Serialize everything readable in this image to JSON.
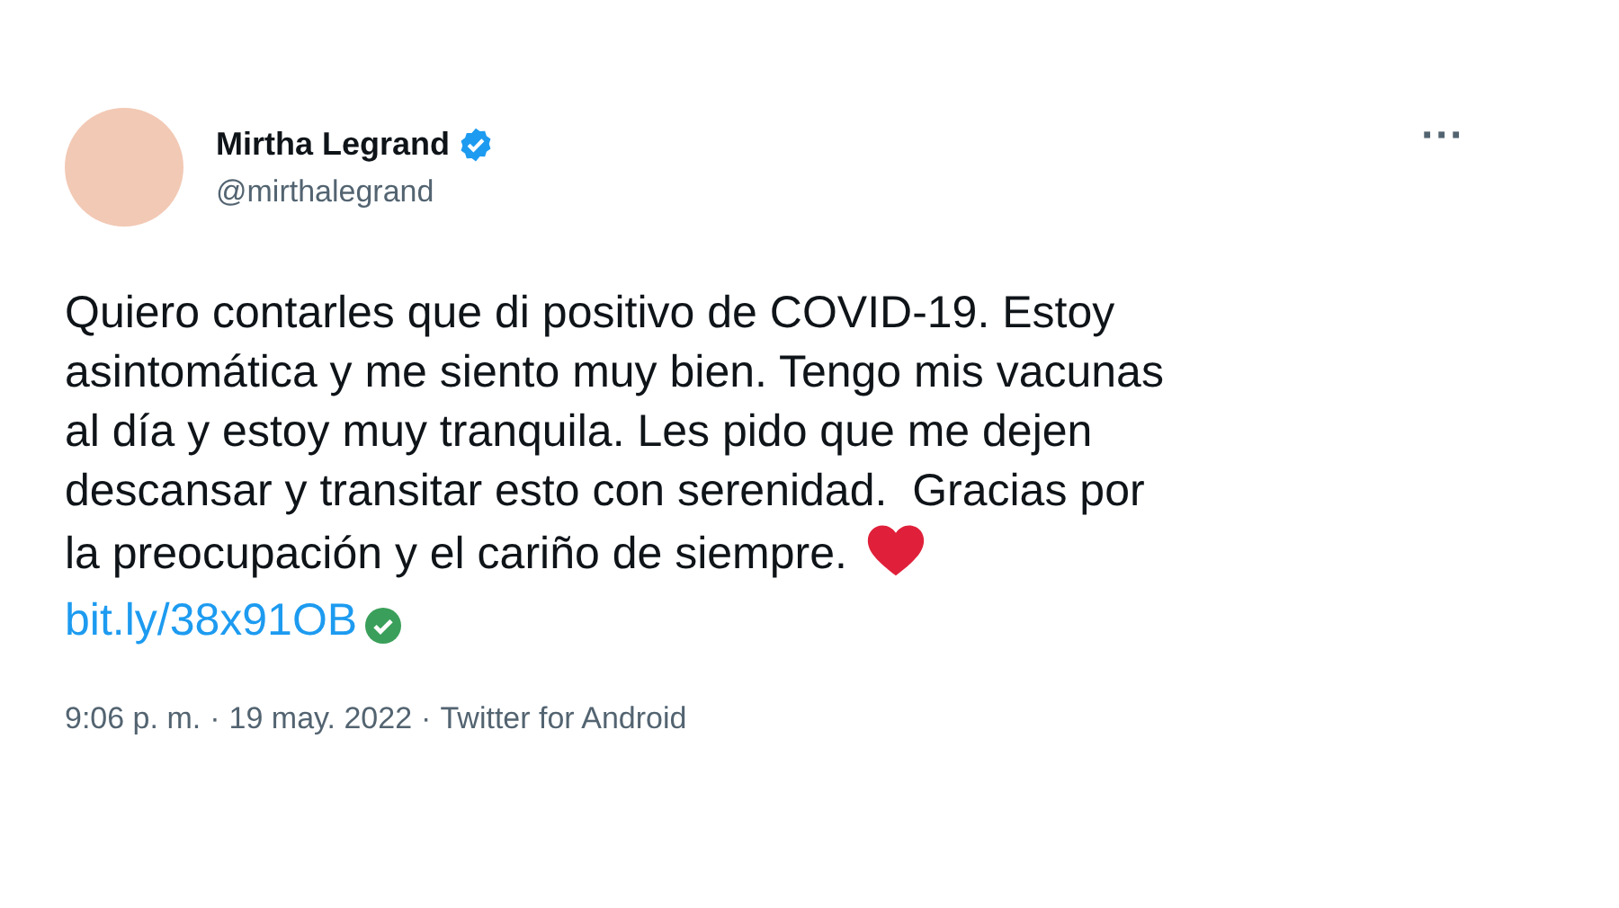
{
  "author": {
    "name": "Mirtha Legrand",
    "verified": true,
    "handle": "@mirthalegrand"
  },
  "more_button": "···",
  "tweet": {
    "text": "Quiero contarles que di positivo de COVID-19. Estoy\nasintomática y me siento muy bien. Tengo mis vacunas\nal día y estoy muy tranquila. Les pido que me dejen\ndescansar y transitar esto con serenidad.  Gracias por\nla preocupación y el cariño de siempre.",
    "link": "bit.ly/38x91OB"
  },
  "meta": {
    "time": "9:06 p. m.",
    "separators": [
      "·",
      "·"
    ],
    "date": "19 may. 2022",
    "source": "Twitter for Android"
  }
}
